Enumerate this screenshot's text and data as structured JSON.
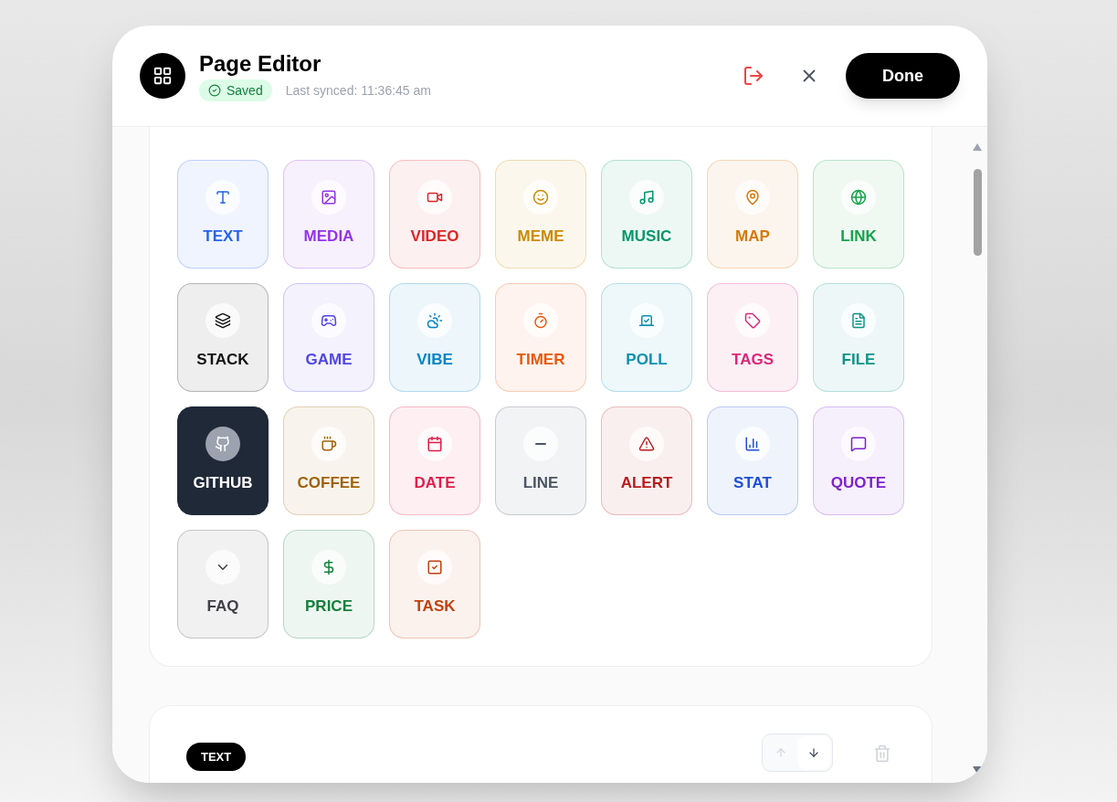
{
  "header": {
    "title": "Page Editor",
    "status": "Saved",
    "last_synced": "Last synced: 11:36:45 am",
    "done_button": "Done"
  },
  "blocks": [
    {
      "label": "TEXT",
      "kind": "light",
      "color": "#2563eb"
    },
    {
      "label": "MEDIA",
      "kind": "light",
      "color": "#9333ea"
    },
    {
      "label": "VIDEO",
      "kind": "light",
      "color": "#dc2626"
    },
    {
      "label": "MEME",
      "kind": "light",
      "color": "#ca8a04"
    },
    {
      "label": "MUSIC",
      "kind": "light",
      "color": "#059669"
    },
    {
      "label": "MAP",
      "kind": "light",
      "color": "#d97706"
    },
    {
      "label": "LINK",
      "kind": "light",
      "color": "#16a34a"
    },
    {
      "label": "STACK",
      "kind": "light",
      "color": "#111111"
    },
    {
      "label": "GAME",
      "kind": "light",
      "color": "#4f46e5"
    },
    {
      "label": "VIBE",
      "kind": "light",
      "color": "#0284c7"
    },
    {
      "label": "TIMER",
      "kind": "light",
      "color": "#ea580c"
    },
    {
      "label": "POLL",
      "kind": "light",
      "color": "#0891b2"
    },
    {
      "label": "TAGS",
      "kind": "light",
      "color": "#db2777"
    },
    {
      "label": "FILE",
      "kind": "light",
      "color": "#0d9488"
    },
    {
      "label": "GITHUB",
      "kind": "dark",
      "color": "#1f2937"
    },
    {
      "label": "COFFEE",
      "kind": "light",
      "color": "#a16207"
    },
    {
      "label": "DATE",
      "kind": "light",
      "color": "#e11d48"
    },
    {
      "label": "LINE",
      "kind": "light",
      "color": "#4b5563"
    },
    {
      "label": "ALERT",
      "kind": "light",
      "color": "#b91c1c"
    },
    {
      "label": "STAT",
      "kind": "light",
      "color": "#1d4ed8"
    },
    {
      "label": "QUOTE",
      "kind": "light",
      "color": "#7e22ce"
    },
    {
      "label": "FAQ",
      "kind": "light",
      "color": "#3f3f46"
    },
    {
      "label": "PRICE",
      "kind": "light",
      "color": "#15803d"
    },
    {
      "label": "TASK",
      "kind": "light",
      "color": "#c2410c"
    }
  ],
  "block_card": {
    "tag": "TEXT",
    "move_up_disabled": true,
    "move_down_disabled": false
  }
}
